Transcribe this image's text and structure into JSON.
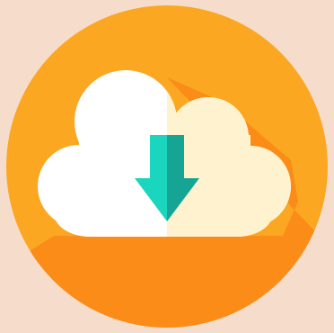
{
  "icon": {
    "name": "cloud-download-icon"
  },
  "colors": {
    "background": "#F6DCCB",
    "circle": "#FBA721",
    "long_shadow": "#FA8C17",
    "cloud_left": "#FFFFFF",
    "cloud_right": "#FFF3CF",
    "arrow_left": "#1AD6BE",
    "arrow_right": "#16A594"
  }
}
